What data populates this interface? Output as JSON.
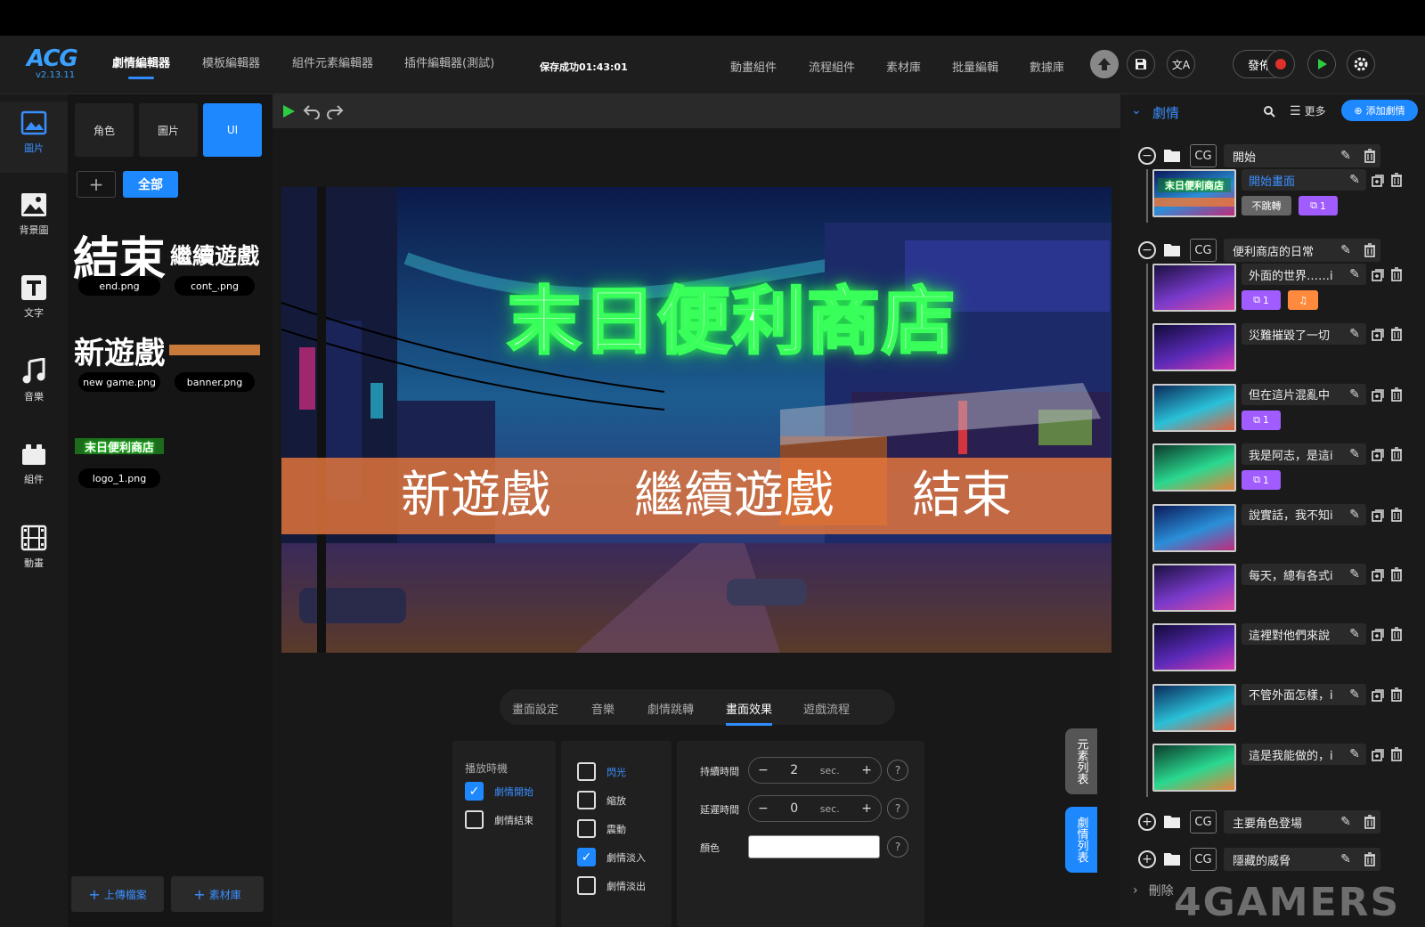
{
  "app": {
    "logo": "ACG",
    "version": "v2.13.11",
    "save_status": "保存成功01:43:01",
    "publish_label": "發佈",
    "colors": {
      "accent": "#1e88ff",
      "purple": "#a15cff",
      "orange": "#ff8a3d",
      "play": "#2ecc40",
      "record": "#e0302a"
    }
  },
  "nav": {
    "left_tabs": [
      {
        "label": "劇情編輯器",
        "active": true
      },
      {
        "label": "模板編輯器"
      },
      {
        "label": "組件元素編輯器"
      },
      {
        "label": "插件編輯器(測試)"
      }
    ],
    "right_tabs": [
      "動畫組件",
      "流程組件",
      "素材庫",
      "批量編輯",
      "數據庫"
    ],
    "icons": [
      "upload-icon",
      "save-icon",
      "translate-icon",
      "record-icon",
      "play-icon",
      "settings-icon"
    ]
  },
  "rail": {
    "items": [
      {
        "label": "圖片",
        "icon": "image-icon",
        "active": true
      },
      {
        "label": "背景圖",
        "icon": "background-icon"
      },
      {
        "label": "文字",
        "icon": "text-icon"
      },
      {
        "label": "音樂",
        "icon": "music-icon"
      },
      {
        "label": "組件",
        "icon": "component-icon"
      },
      {
        "label": "動畫",
        "icon": "film-icon"
      }
    ]
  },
  "assets": {
    "tabs": [
      {
        "label": "角色"
      },
      {
        "label": "圖片"
      },
      {
        "label": "UI",
        "active": true
      }
    ],
    "filter_all": "全部",
    "items": [
      {
        "preview": "結束",
        "file": "end.png"
      },
      {
        "preview": "繼續遊戲",
        "file": "cont_.png"
      },
      {
        "preview": "新遊戲",
        "file": "new game.png"
      },
      {
        "preview": "",
        "file": "banner.png"
      },
      {
        "preview": "末日便利商店",
        "file": "logo_1.png"
      }
    ],
    "upload_label": "上傳檔案",
    "library_label": "素材庫"
  },
  "stage": {
    "title": "末日便利商店",
    "menu": [
      "新遊戲",
      "繼續遊戲",
      "結束"
    ]
  },
  "bottom_tabs": [
    {
      "label": "畫面設定"
    },
    {
      "label": "音樂"
    },
    {
      "label": "劇情跳轉"
    },
    {
      "label": "畫面效果",
      "active": true
    },
    {
      "label": "遊戲流程"
    }
  ],
  "effects": {
    "timing_title": "播放時機",
    "timing": [
      {
        "label": "劇情開始",
        "checked": true
      },
      {
        "label": "劇情結束",
        "checked": false
      }
    ],
    "types": [
      {
        "label": "閃光",
        "checked": false,
        "highlight": true
      },
      {
        "label": "縮放",
        "checked": false
      },
      {
        "label": "震動",
        "checked": false
      },
      {
        "label": "劇情淡入",
        "checked": true
      },
      {
        "label": "劇情淡出",
        "checked": false
      }
    ],
    "duration_label": "持續時間",
    "duration_value": "2",
    "delay_label": "延遲時間",
    "delay_value": "0",
    "unit": "sec.",
    "color_label": "顏色",
    "color_value": "#ffffff",
    "help": "?"
  },
  "side_tabs": {
    "elements": "元素列表",
    "story": "劇情列表"
  },
  "story": {
    "header": "劇情",
    "more": "更多",
    "add": "添加劇情",
    "cg": "CG",
    "groups": [
      {
        "name": "開始",
        "expanded": true,
        "scenes": [
          {
            "name": "開始畫面",
            "highlight": true,
            "badges": [
              {
                "text": "不跳轉",
                "kind": "gray"
              },
              {
                "text": "1",
                "kind": "purple"
              }
            ]
          }
        ]
      },
      {
        "name": "便利商店的日常",
        "expanded": true,
        "scenes": [
          {
            "name": "外面的世界……i",
            "badges": [
              {
                "text": "1",
                "kind": "purple"
              },
              {
                "text": "♫",
                "kind": "orange"
              }
            ]
          },
          {
            "name": "災難摧毀了一切",
            "badges": []
          },
          {
            "name": "但在這片混亂中",
            "badges": [
              {
                "text": "1",
                "kind": "purple"
              }
            ]
          },
          {
            "name": "我是阿志，是這i",
            "badges": [
              {
                "text": "1",
                "kind": "purple"
              }
            ]
          },
          {
            "name": "說實話，我不知i",
            "badges": []
          },
          {
            "name": "每天，總有各式i",
            "badges": []
          },
          {
            "name": "這裡對他們來說",
            "badges": []
          },
          {
            "name": "不管外面怎樣，i",
            "badges": []
          },
          {
            "name": "這是我能做的，i",
            "badges": []
          }
        ]
      },
      {
        "name": "主要角色登場",
        "expanded": false,
        "scenes": []
      },
      {
        "name": "隱藏的威脅",
        "expanded": false,
        "scenes": []
      }
    ],
    "delete_label": "刪除"
  },
  "watermark": "4GAMERS"
}
